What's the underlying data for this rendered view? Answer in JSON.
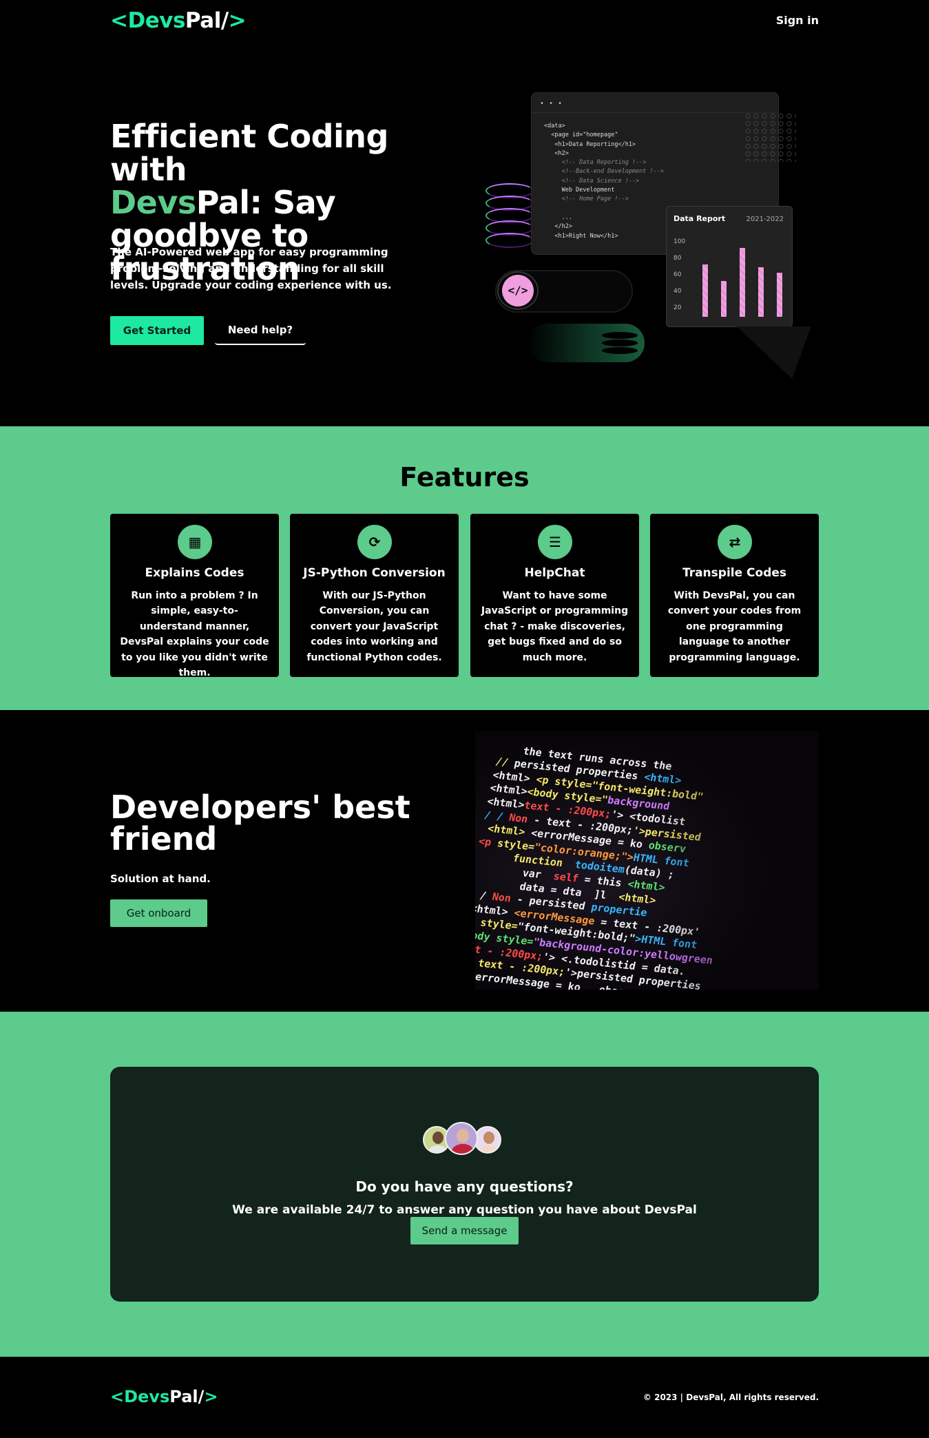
{
  "brand": {
    "open": "<",
    "part1": "Devs",
    "part2": "Pal/",
    "close": ">"
  },
  "nav": {
    "sign_in": "Sign in"
  },
  "hero": {
    "title_line1": "Efficient Coding with",
    "title_green": "Devs",
    "title_rest": "Pal: Say goodbye to frustration",
    "subtitle": "The AI-Powered web app for easy programming problem-solving and understanding for all skill levels. Upgrade your coding experience with us.",
    "cta_primary": "Get Started",
    "cta_secondary": "Need help?"
  },
  "illustration": {
    "window_dots": "• • •",
    "code_lines": [
      "<data>",
      "  <page id=\"homepage\"",
      "   <h1>Data Reporting</h1>",
      "   <h2>",
      "     <!-- Data Reporting !-->",
      "     <!--Back-end Development !-->",
      "     <!-- Data Science !-->",
      "     Web Development",
      "     <!-- Home Page !-->",
      "",
      "     ...",
      "   </h2>",
      "   <h1>Right Now</h1>"
    ],
    "report": {
      "title": "Data Report",
      "year": "2021-2022",
      "y_ticks": [
        "100",
        "80",
        "60",
        "40",
        "20"
      ],
      "bar_values": [
        75,
        55,
        95,
        72,
        65
      ]
    },
    "pill_icon": "</>"
  },
  "features": {
    "title": "Features",
    "items": [
      {
        "icon": "chip-icon",
        "glyph": "▦",
        "title": "Explains Codes",
        "desc": "Run into a problem ? In simple, easy-to-understand manner, DevsPal explains your code to you like you didn't write them."
      },
      {
        "icon": "convert-icon",
        "glyph": "⟳",
        "title": "JS-Python Conversion",
        "desc": "With our JS-Python Conversion, you can convert your JavaScript codes into working and functional Python codes."
      },
      {
        "icon": "chat-icon",
        "glyph": "☰",
        "title": "HelpChat",
        "desc": "Want to have some JavaScript or programming chat ? - make discoveries, get bugs fixed and do so much more."
      },
      {
        "icon": "swap-icon",
        "glyph": "⇄",
        "title": "Transpile Codes",
        "desc": "With DevsPal, you can convert your codes from one programming language to another programming language."
      }
    ]
  },
  "developers": {
    "title": "Developers' best friend",
    "subtitle": "Solution at hand.",
    "cta": "Get onboard"
  },
  "questions": {
    "title": "Do you have any questions?",
    "subtitle": "We are available 24/7 to answer any question you have about DevsPal",
    "cta": "Send a message"
  },
  "footer": {
    "copyright": "© 2023 | DevsPal, All rights reserved."
  },
  "colors": {
    "accent": "#1de9a0",
    "green": "#5ccb8b",
    "dark_card": "#12241b",
    "pink": "#f19ee0"
  }
}
